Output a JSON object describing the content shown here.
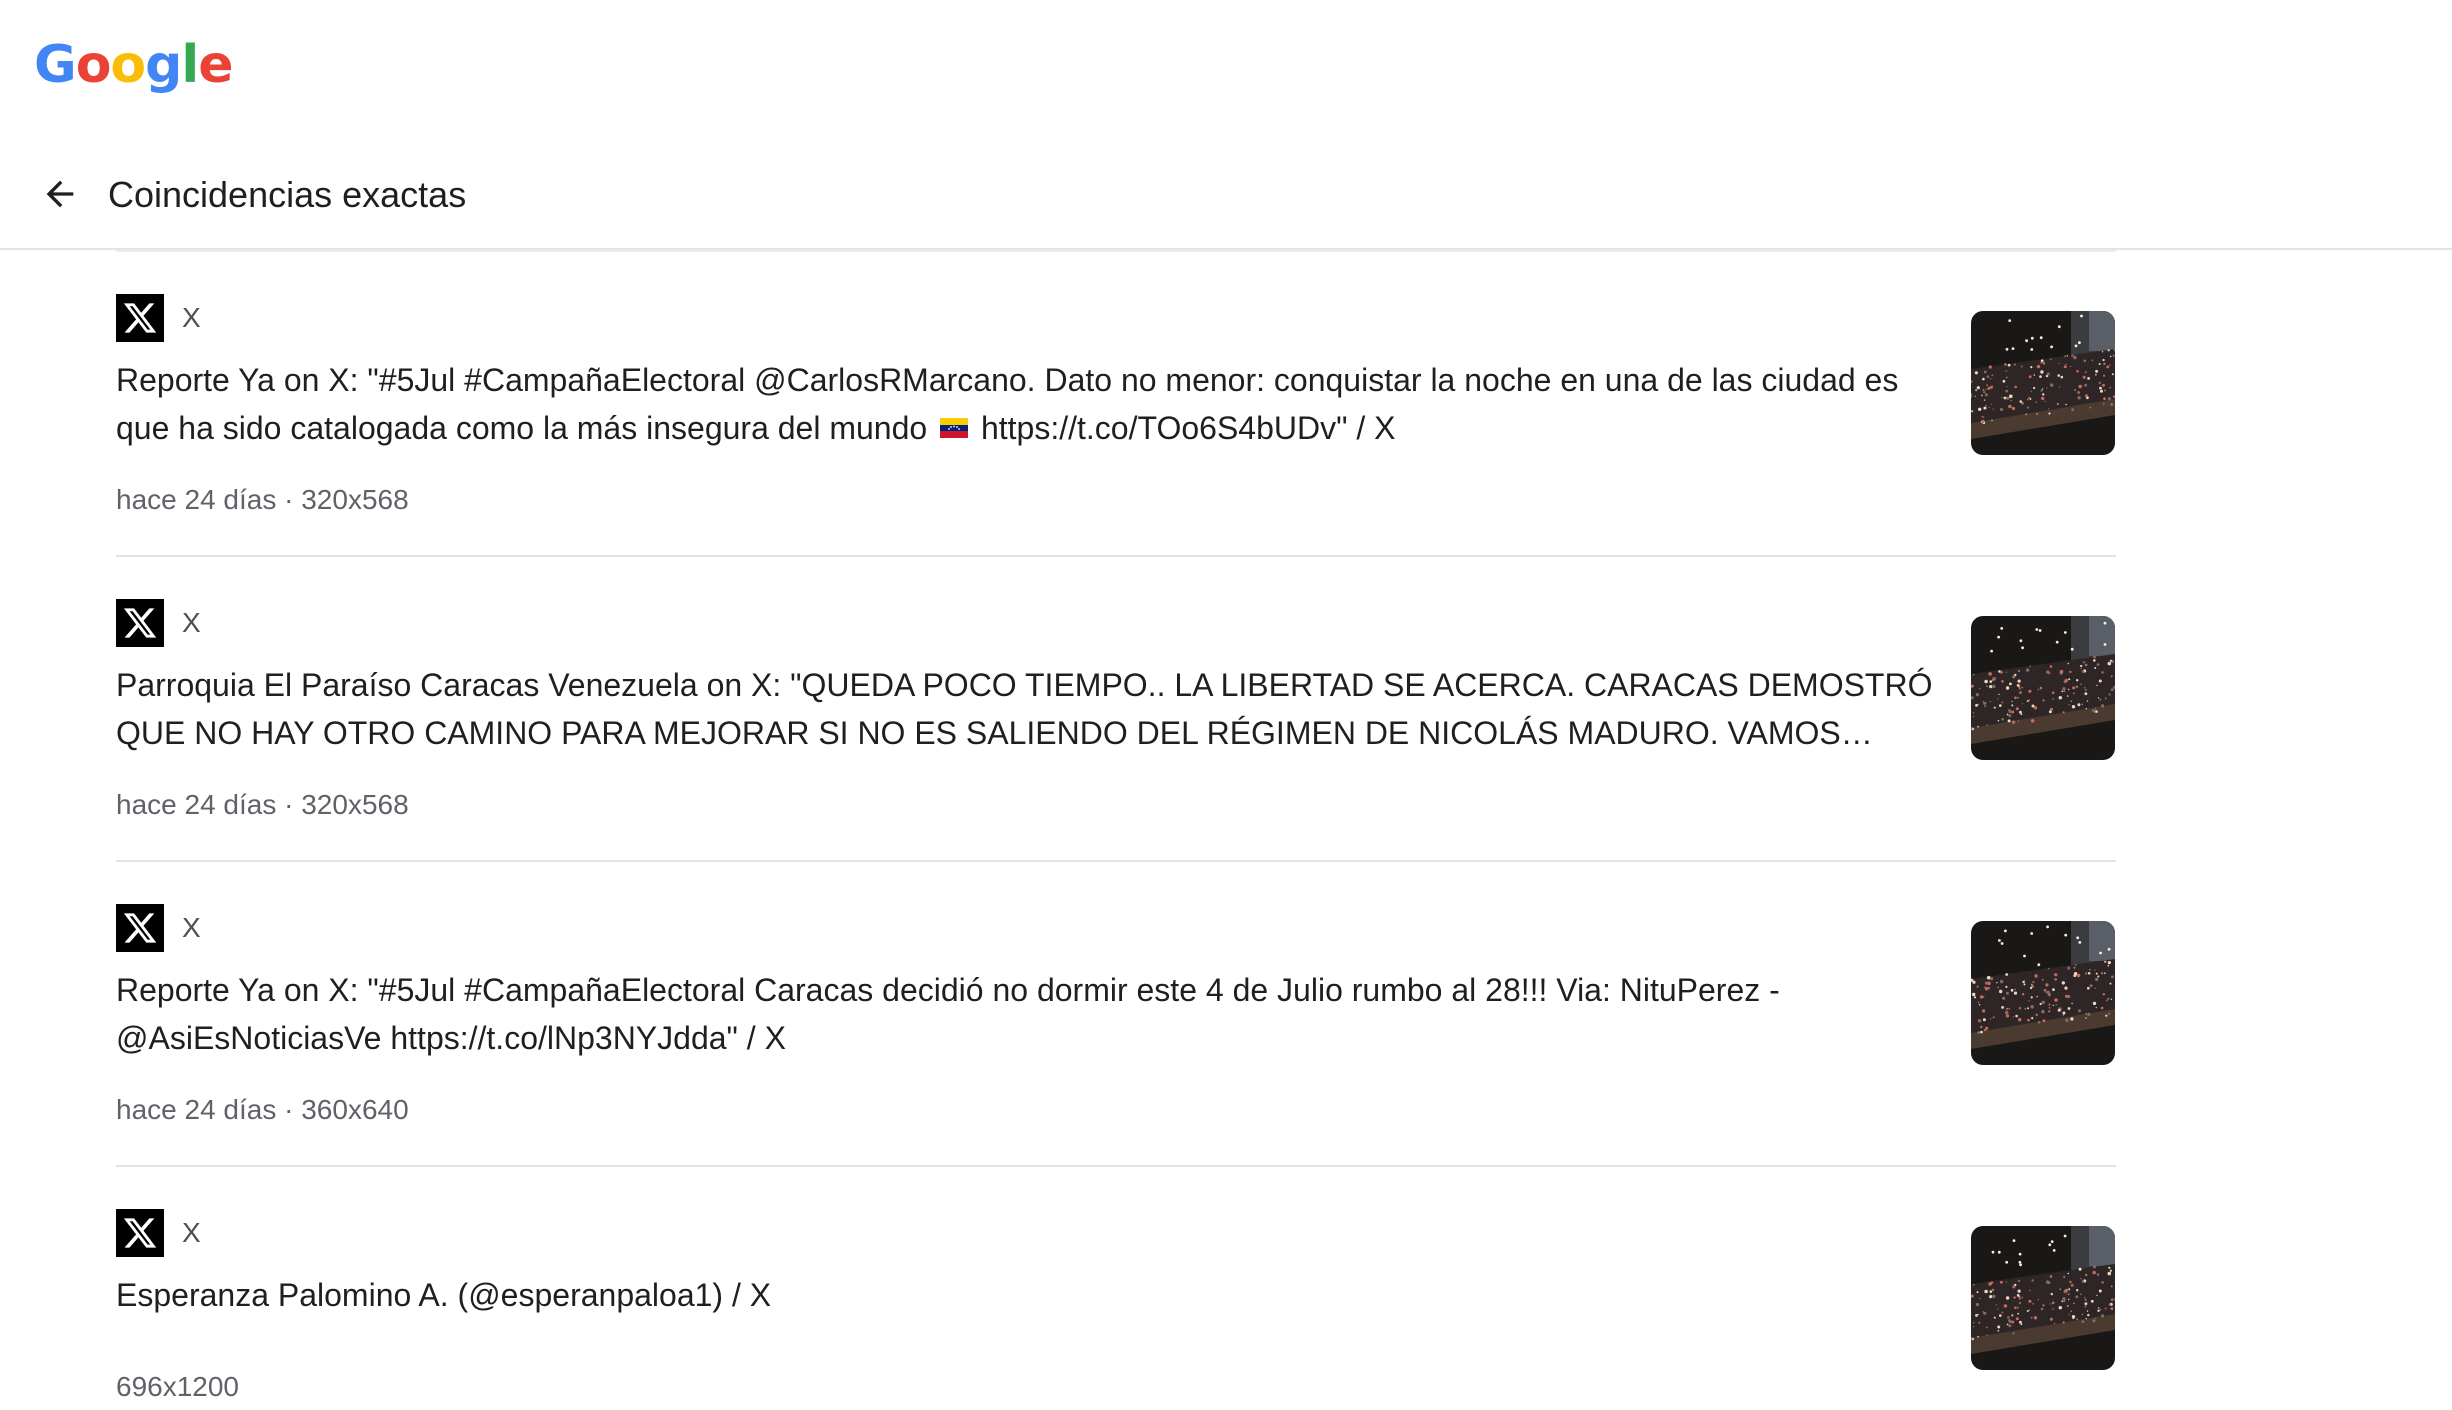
{
  "logo": {
    "letters": [
      "G",
      "o",
      "o",
      "g",
      "l",
      "e"
    ],
    "colors": [
      "#4285F4",
      "#EA4335",
      "#FBBC05",
      "#4285F4",
      "#34A853",
      "#EA4335"
    ]
  },
  "header": {
    "back_icon": "arrow-back-icon",
    "title": "Coincidencias exactas"
  },
  "results": [
    {
      "source": "X",
      "title_before_flag": "Reporte Ya on X: \"#5Jul #CampañaElectoral @CarlosRMarcano. Dato no menor: conquistar la noche en una de las ciudad es que ha sido catalogada como la más insegura del mundo",
      "title_after_flag": "https://t.co/TOo6S4bUDv\" / X",
      "has_flag": true,
      "meta": "hace 24 días · 320x568"
    },
    {
      "source": "X",
      "title_before_flag": "Parroquia El Paraíso Caracas Venezuela on X: \"QUEDA POCO TIEMPO.. LA LIBERTAD SE ACERCA. CARACAS DEMOSTRÓ QUE NO HAY OTRO CAMINO PARA MEJORAR SI NO ES SALIENDO DEL RÉGIMEN DE NICOLÁS MADURO. VAMOS VENEZ...",
      "title_after_flag": "",
      "has_flag": false,
      "meta": "hace 24 días · 320x568"
    },
    {
      "source": "X",
      "title_before_flag": "Reporte Ya on X: \"#5Jul #CampañaElectoral Caracas decidió no dormir este 4 de Julio rumbo al 28!!! Via: NituPerez - @AsiEsNoticiasVe https://t.co/lNp3NYJdda\" / X",
      "title_after_flag": "",
      "has_flag": false,
      "meta": "hace 24 días · 360x640"
    },
    {
      "source": "X",
      "title_before_flag": "Esperanza Palomino A. (@esperanpaloa1) / X",
      "title_after_flag": "",
      "has_flag": false,
      "meta": "696x1200"
    }
  ],
  "colors": {
    "flag": [
      "#FFCC00",
      "#00247D",
      "#CF142B"
    ]
  }
}
